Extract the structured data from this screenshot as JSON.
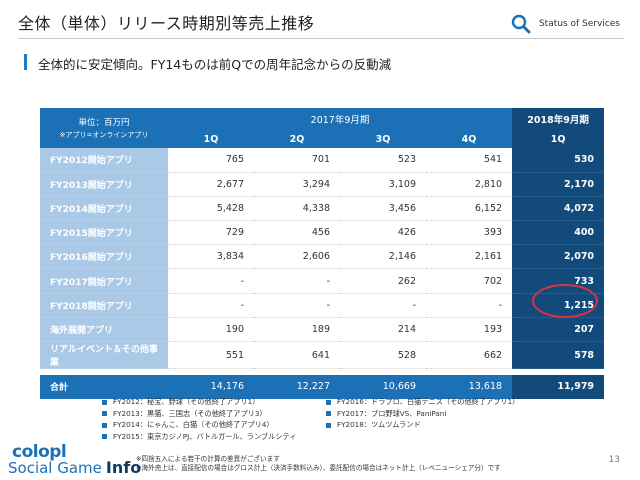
{
  "header": {
    "title": "全体（単体）リリース時期別等売上推移",
    "status_label": "Status of Services"
  },
  "subtitle": "全体的に安定傾向。FY14ものは前Qでの周年記念からの反動減",
  "table": {
    "unit_label": "単位：百万円",
    "unit_note": "※アプリ=オンラインアプリ",
    "period_2017": "2017年9月期",
    "period_2018": "2018年9月期",
    "quarters": [
      "1Q",
      "2Q",
      "3Q",
      "4Q"
    ],
    "quarter_2018": "1Q",
    "rows": [
      {
        "label": "FY2012開始アプリ",
        "values": [
          "765",
          "701",
          "523",
          "541"
        ],
        "latest": "530"
      },
      {
        "label": "FY2013開始アプリ",
        "values": [
          "2,677",
          "3,294",
          "3,109",
          "2,810"
        ],
        "latest": "2,170"
      },
      {
        "label": "FY2014開始アプリ",
        "values": [
          "5,428",
          "4,338",
          "3,456",
          "6,152"
        ],
        "latest": "4,072"
      },
      {
        "label": "FY2015開始アプリ",
        "values": [
          "729",
          "456",
          "426",
          "393"
        ],
        "latest": "400"
      },
      {
        "label": "FY2016開始アプリ",
        "values": [
          "3,834",
          "2,606",
          "2,146",
          "2,161"
        ],
        "latest": "2,070"
      },
      {
        "label": "FY2017開始アプリ",
        "values": [
          "-",
          "-",
          "262",
          "702"
        ],
        "latest": "733"
      },
      {
        "label": "FY2018開始アプリ",
        "values": [
          "-",
          "-",
          "-",
          "-"
        ],
        "latest": "1,215"
      },
      {
        "label": "海外展開アプリ",
        "values": [
          "190",
          "189",
          "214",
          "193"
        ],
        "latest": "207"
      },
      {
        "label": "リアルイベント＆その他事業",
        "values": [
          "551",
          "641",
          "528",
          "662"
        ],
        "latest": "578"
      }
    ],
    "total": {
      "label": "合計",
      "values": [
        "14,176",
        "12,227",
        "10,669",
        "13,618"
      ],
      "latest": "11,979"
    }
  },
  "legend": [
    "FY2012：秘宝、野球（その他終了アプリ1）",
    "FY2016：ドラプロ、白猫テニス（その他終了アプリ1）",
    "FY2013：黒猫、三国志（その他終了アプリ3）",
    "FY2017：プロ野球VS、PaniPani",
    "FY2014：にゃんこ、白猫（その他終了アプリ4）",
    "FY2018：ツムツムランド",
    "FY2015：東京カジノPJ、バトルガール、ランブルシティ"
  ],
  "logo": {
    "top": "colopl",
    "bottom_main": "Social Game",
    "bottom_info": "Info"
  },
  "notes": [
    "※四捨五入による若干の計算の差異がございます",
    "※海外売上は、直接配信の場合はグロス計上（決済手数料込み）、委託配信の場合はネット計上（レベニューシェア分）です"
  ],
  "page_number": "13",
  "colors": {
    "primary": "#1c70b6",
    "dark": "#134a7c",
    "row_header": "#a9c9e6",
    "highlight_oval": "#e03040"
  }
}
